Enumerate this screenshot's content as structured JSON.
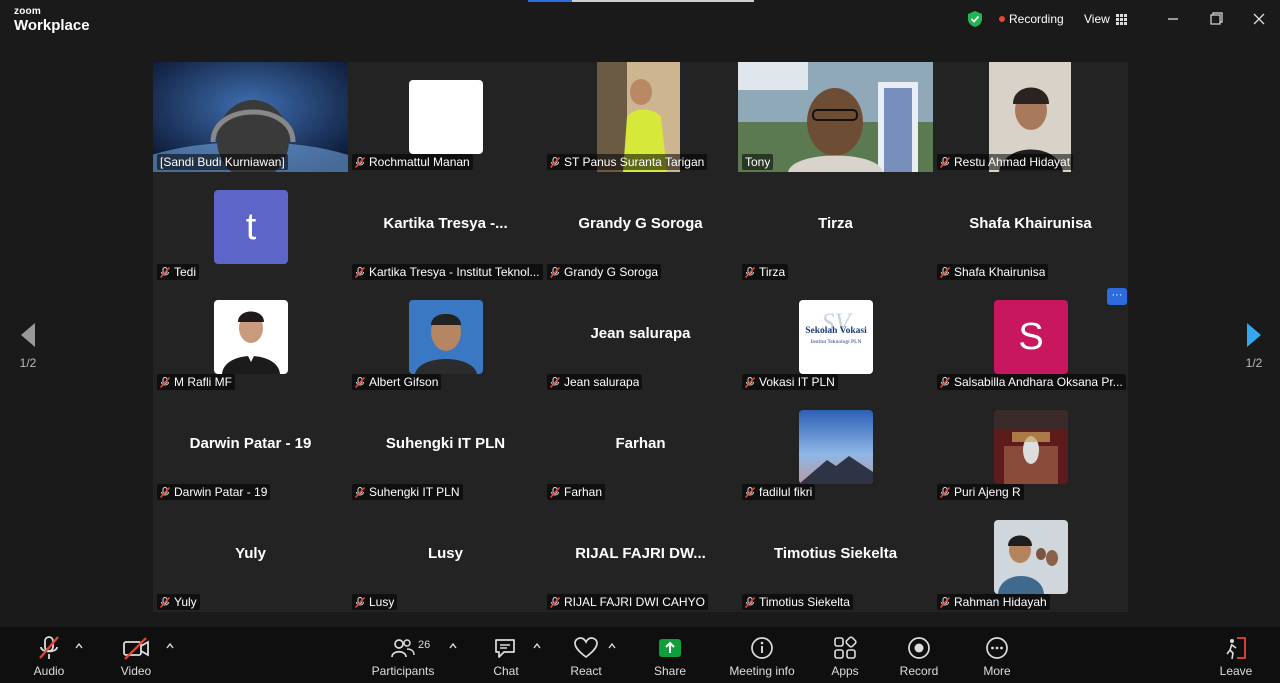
{
  "app": {
    "brand_line1": "zoom",
    "brand_line2": "Workplace"
  },
  "topbar": {
    "recording_label": "Recording",
    "view_label": "View"
  },
  "colors": {
    "accent": "#2d6cdf",
    "active_speaker": "#3ec77a",
    "recording": "#e5453a",
    "share_green": "#0e9f3c",
    "leave_red": "#e5453a"
  },
  "pager": {
    "left": "1/2",
    "right": "1/2"
  },
  "more_button": "···",
  "tiles": [
    {
      "name": "[Sandi Budi Kurniawan]",
      "big": "",
      "type": "video-space",
      "muted": false,
      "active": true
    },
    {
      "name": "Rochmattul Manan",
      "big": "",
      "type": "avatar-white",
      "muted": true
    },
    {
      "name": "ST Panus Suranta Tarigan",
      "big": "",
      "type": "video-person",
      "muted": true
    },
    {
      "name": "Tony",
      "big": "",
      "type": "video-campus",
      "muted": false
    },
    {
      "name": "Restu Ahmad Hidayat",
      "big": "",
      "type": "video-person2",
      "muted": true
    },
    {
      "name": "Tedi",
      "big": "",
      "type": "avatar-letter",
      "letter": "t",
      "muted": true
    },
    {
      "name": "Kartika Tresya - Institut Teknol...",
      "big": "Kartika  Tresya  -...",
      "type": "name",
      "muted": true
    },
    {
      "name": "Grandy G Soroga",
      "big": "Grandy G Soroga",
      "type": "name",
      "muted": true
    },
    {
      "name": "Tirza",
      "big": "Tirza",
      "type": "name",
      "muted": true
    },
    {
      "name": "Shafa Khairunisa",
      "big": "Shafa Khairunisa",
      "type": "name",
      "muted": true
    },
    {
      "name": "M Rafli MF",
      "big": "",
      "type": "avatar-suit",
      "muted": true
    },
    {
      "name": "Albert Gifson",
      "big": "",
      "type": "avatar-photo",
      "muted": true
    },
    {
      "name": "Jean salurapa",
      "big": "Jean salurapa",
      "type": "name",
      "muted": true
    },
    {
      "name": "Vokasi IT PLN",
      "big": "",
      "type": "avatar-logo",
      "logo_text": "Sekolah Vokasi",
      "logo_sub": "Institut Teknologi PLN",
      "muted": true
    },
    {
      "name": "Salsabilla Andhara Oksana Pr...",
      "big": "",
      "type": "avatar-letter2",
      "letter": "S",
      "muted": true
    },
    {
      "name": "Darwin Patar  - 19",
      "big": "Darwin Patar  - 19",
      "type": "name",
      "muted": true
    },
    {
      "name": "Suhengki IT PLN",
      "big": "Suhengki IT PLN",
      "type": "name",
      "muted": true
    },
    {
      "name": "Farhan",
      "big": "Farhan",
      "type": "name",
      "muted": true
    },
    {
      "name": "fadilul fikri",
      "big": "",
      "type": "avatar-mountain",
      "muted": true
    },
    {
      "name": "Puri Ajeng R",
      "big": "",
      "type": "avatar-stage",
      "muted": true
    },
    {
      "name": "Yuly",
      "big": "Yuly",
      "type": "name",
      "muted": true
    },
    {
      "name": "Lusy",
      "big": "Lusy",
      "type": "name",
      "muted": true
    },
    {
      "name": "RIJAL FAJRI DWI CAHYO",
      "big": "RIJAL FAJRI DW...",
      "type": "name",
      "muted": true
    },
    {
      "name": "Timotius Siekelta",
      "big": "Timotius Siekelta",
      "type": "name",
      "muted": true
    },
    {
      "name": "Rahman Hidayah",
      "big": "",
      "type": "avatar-group",
      "muted": true
    }
  ],
  "toolbar": {
    "audio": "Audio",
    "video": "Video",
    "participants": "Participants",
    "participants_count": "26",
    "chat": "Chat",
    "react": "React",
    "share": "Share",
    "meeting_info": "Meeting info",
    "apps": "Apps",
    "record": "Record",
    "more": "More",
    "leave": "Leave"
  }
}
